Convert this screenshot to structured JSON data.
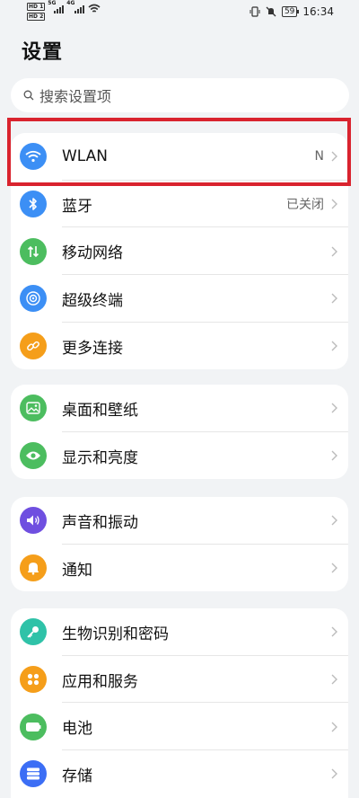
{
  "status_bar": {
    "hd1": "HD 1",
    "hd2": "HD 2",
    "net1": "5G",
    "net2": "4G",
    "battery": "59",
    "time": "16:34"
  },
  "page_title": "设置",
  "search": {
    "placeholder": "搜索设置项",
    "icon": "search-icon"
  },
  "colors": {
    "wlan": "#3c8ff5",
    "bluetooth": "#3c8ff5",
    "mobile": "#4cbd5f",
    "superterminal": "#3c8ff5",
    "moreconn": "#f59e1a",
    "wallpaper": "#4cbd5f",
    "display": "#4cbd5f",
    "sound": "#6f4fe0",
    "notify": "#f59e1a",
    "biometric": "#2fc2a8",
    "apps": "#f59e1a",
    "battery": "#4cbd5f",
    "storage": "#3c6ef5",
    "highlight": "#d9232e"
  },
  "groups": [
    {
      "items": [
        {
          "label": "WLAN",
          "value": "N",
          "icon": "wifi-icon"
        },
        {
          "label": "蓝牙",
          "value": "已关闭",
          "icon": "bluetooth-icon"
        },
        {
          "label": "移动网络",
          "value": "",
          "icon": "mobile-network-icon"
        },
        {
          "label": "超级终端",
          "value": "",
          "icon": "super-terminal-icon"
        },
        {
          "label": "更多连接",
          "value": "",
          "icon": "link-icon"
        }
      ]
    },
    {
      "items": [
        {
          "label": "桌面和壁纸",
          "value": "",
          "icon": "wallpaper-icon"
        },
        {
          "label": "显示和亮度",
          "value": "",
          "icon": "eye-icon"
        }
      ]
    },
    {
      "items": [
        {
          "label": "声音和振动",
          "value": "",
          "icon": "speaker-icon"
        },
        {
          "label": "通知",
          "value": "",
          "icon": "bell-icon"
        }
      ]
    },
    {
      "items": [
        {
          "label": "生物识别和密码",
          "value": "",
          "icon": "key-icon"
        },
        {
          "label": "应用和服务",
          "value": "",
          "icon": "apps-icon"
        },
        {
          "label": "电池",
          "value": "",
          "icon": "battery-icon"
        },
        {
          "label": "存储",
          "value": "",
          "icon": "storage-icon"
        }
      ]
    }
  ]
}
